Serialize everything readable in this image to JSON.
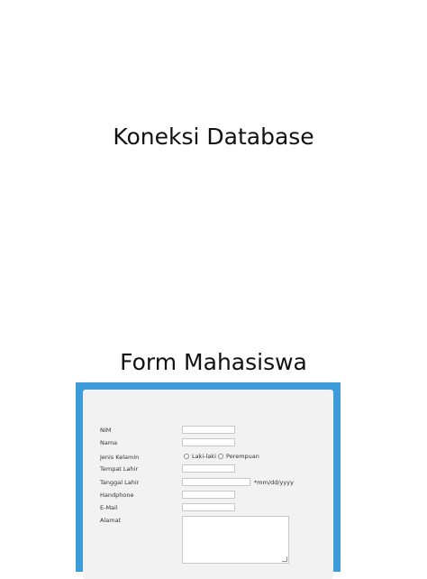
{
  "slide1": {
    "title": "Koneksi Database"
  },
  "slide2": {
    "title": "Form Mahasiswa"
  },
  "form": {
    "nim_label": "NIM",
    "nama_label": "Nama",
    "jenis_kelamin_label": "Jenis Kelamin",
    "radio_laki": "Laki-laki",
    "radio_perempuan": "Perempuan",
    "tempat_lahir_label": "Tempat Lahir",
    "tanggal_lahir_label": "Tanggal Lahir",
    "tanggal_hint": "*mm/dd/yyyy",
    "handphone_label": "Handphone",
    "email_label": "E-Mail",
    "alamat_label": "Alamat"
  },
  "colors": {
    "frame": "#3d9bd9",
    "panel": "#f2f2f2"
  }
}
